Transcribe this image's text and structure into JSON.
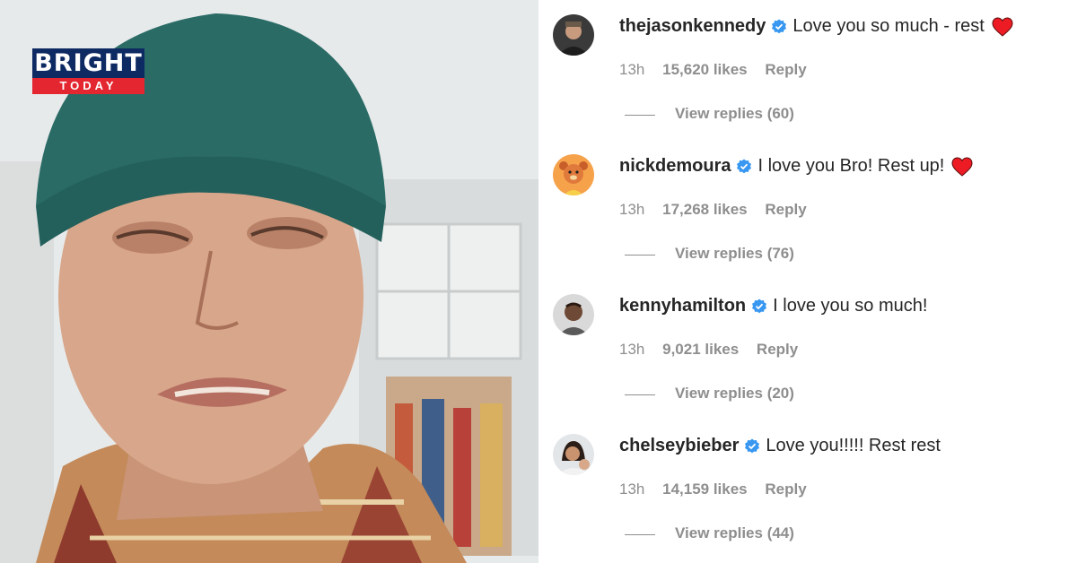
{
  "logo": {
    "top": "BRIGHT",
    "bottom": "TODAY"
  },
  "colors": {
    "username": "#262626",
    "meta": "#8e8e8e",
    "verified": "#3897f0",
    "heart": "#ed1c24",
    "logo_navy": "#0e2a63",
    "logo_red": "#e3262f"
  },
  "comments": [
    {
      "username": "thejasonkennedy",
      "text": "Love you so much - rest",
      "heart": true,
      "time": "13h",
      "likes": "15,620 likes",
      "reply": "Reply",
      "view_replies": "View replies (60)",
      "avatar_icon": "avatar-person-icon"
    },
    {
      "username": "nickdemoura",
      "text": "I love you Bro! Rest up!",
      "heart": true,
      "time": "13h",
      "likes": "17,268 likes",
      "reply": "Reply",
      "view_replies": "View replies (76)",
      "avatar_icon": "avatar-bear-cartoon-icon"
    },
    {
      "username": "kennyhamilton",
      "text": "I love you so much!",
      "heart": false,
      "time": "13h",
      "likes": "9,021 likes",
      "reply": "Reply",
      "view_replies": "View replies (20)",
      "avatar_icon": "avatar-person-icon"
    },
    {
      "username": "chelseybieber",
      "text": "Love you!!!!! Rest rest",
      "heart": false,
      "time": "13h",
      "likes": "14,159 likes",
      "reply": "Reply",
      "view_replies": "View replies (44)",
      "avatar_icon": "avatar-person-icon"
    }
  ]
}
